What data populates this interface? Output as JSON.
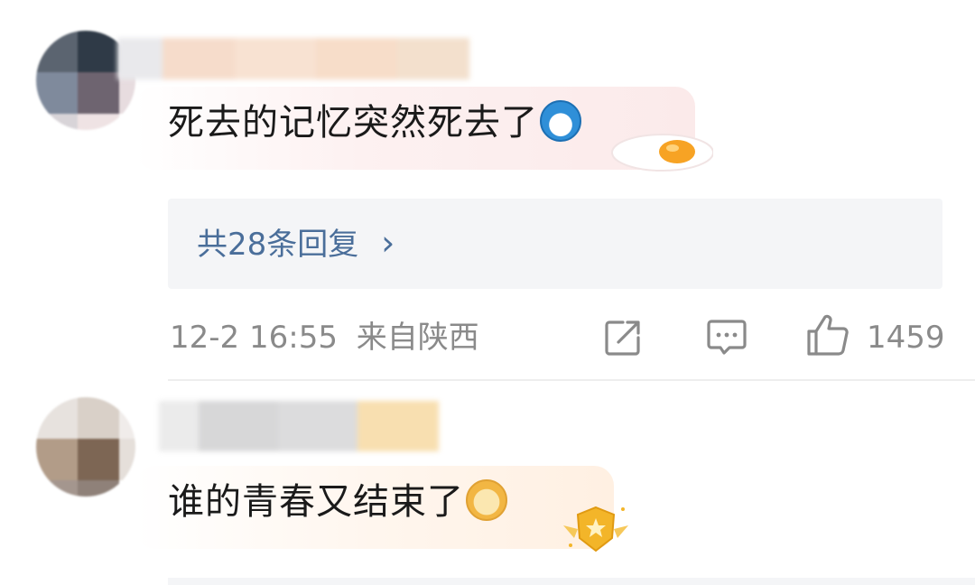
{
  "comments": [
    {
      "text": "死去的记忆突然死去了",
      "emoji_icon": "doraemon-emoji-icon",
      "badge_icon": "fried-egg-badge-icon",
      "replies_label": "共28条回复",
      "reply_chevron": "›",
      "timestamp": "12-2 16:55",
      "location": "来自陕西",
      "like_count": "1459",
      "colors": {
        "reply_link": "#4a6e9a",
        "meta_text": "#8a8a8a",
        "bubble": "#fdeeee"
      }
    },
    {
      "text": "谁的青春又结束了",
      "emoji_icon": "crying-dog-emoji-icon",
      "badge_icon": "gold-shield-badge-icon",
      "colors": {
        "bubble": "#fff3e6"
      }
    }
  ]
}
